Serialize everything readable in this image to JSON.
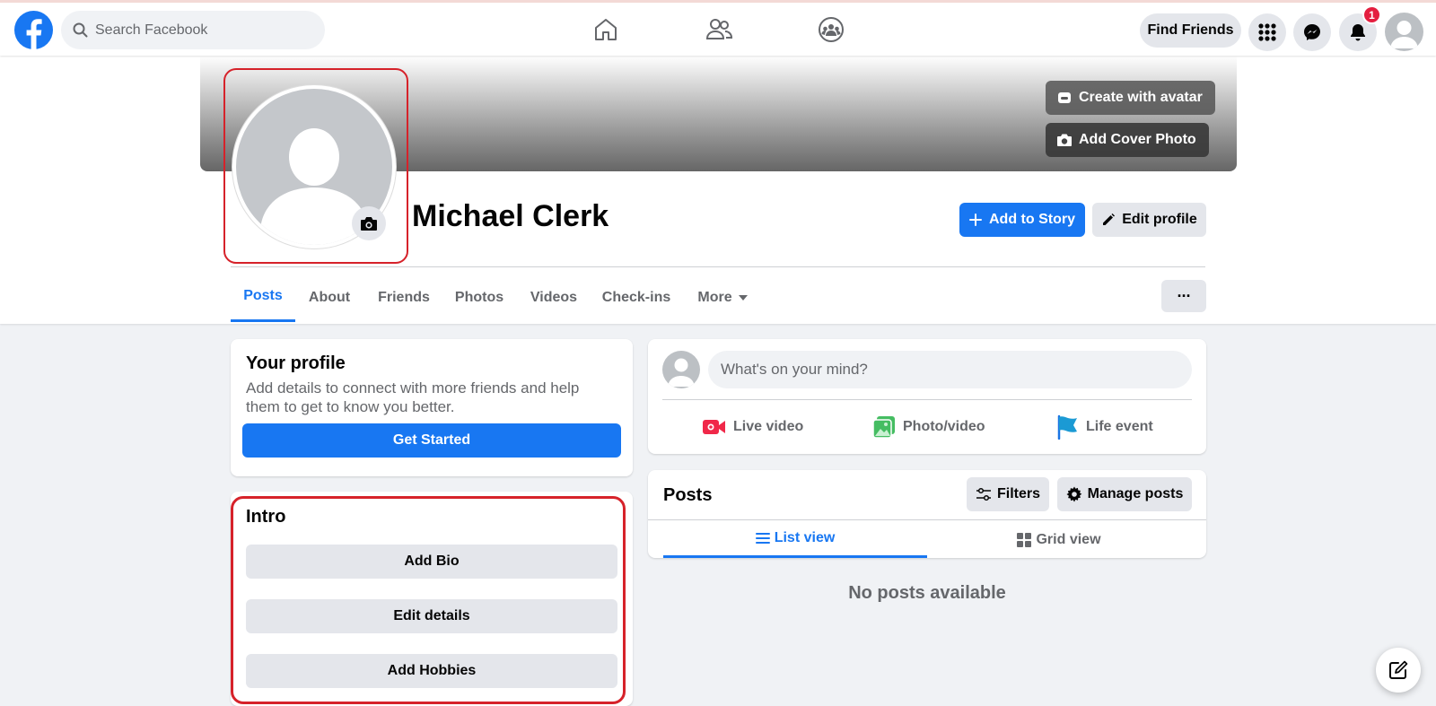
{
  "topbar": {
    "search_placeholder": "Search Facebook",
    "find_friends_label": "Find Friends",
    "notification_count": "1",
    "nav_icons": [
      "home-icon",
      "friends-icon",
      "groups-icon"
    ],
    "right_icons": [
      "menu-grid-icon",
      "messenger-icon",
      "bell-icon",
      "account-avatar"
    ]
  },
  "profile": {
    "name": "Michael Clerk",
    "create_avatar_label": "Create with avatar",
    "add_cover_label": "Add Cover Photo",
    "add_story_label": "Add to Story",
    "edit_profile_label": "Edit profile",
    "more_options_label": "···"
  },
  "tabs": [
    {
      "label": "Posts",
      "active": true
    },
    {
      "label": "About",
      "active": false
    },
    {
      "label": "Friends",
      "active": false
    },
    {
      "label": "Photos",
      "active": false
    },
    {
      "label": "Videos",
      "active": false
    },
    {
      "label": "Check-ins",
      "active": false
    },
    {
      "label": "More",
      "active": false
    }
  ],
  "your_profile": {
    "title": "Your profile",
    "description": "Add details to connect with more friends and help them to get to know you better.",
    "button_label": "Get Started"
  },
  "intro": {
    "title": "Intro",
    "buttons": [
      "Add Bio",
      "Edit details",
      "Add Hobbies"
    ]
  },
  "composer": {
    "placeholder": "What's on your mind?",
    "actions": [
      "Live video",
      "Photo/video",
      "Life event"
    ]
  },
  "posts": {
    "title": "Posts",
    "filters_label": "Filters",
    "manage_label": "Manage posts",
    "list_view_label": "List view",
    "grid_view_label": "Grid view",
    "empty_text": "No posts available"
  },
  "colors": {
    "brand_blue": "#1877f2",
    "highlight_red": "#d6222a",
    "badge_red": "#e41e3f"
  }
}
